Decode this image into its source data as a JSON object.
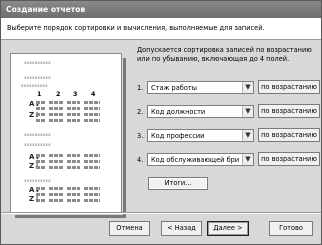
{
  "window": {
    "title": "Создание отчетов"
  },
  "header": {
    "instruction": "Выберите порядок сортировки и вычисления, выполняемые для записей."
  },
  "preview": {
    "placeholder": "xxxxxxxxxx",
    "column_numbers": [
      "1",
      "2",
      "3",
      "4"
    ]
  },
  "description": "Допускается сортировка записей по возрастанию или по убыванию, включающая до 4 полей.",
  "sort_fields": [
    {
      "number": "1.",
      "value": "Стаж работы",
      "order": "по возрастанию"
    },
    {
      "number": "2.",
      "value": "Код должности",
      "order": "по возрастанию"
    },
    {
      "number": "3.",
      "value": "Код профессии",
      "order": "по возрастанию"
    },
    {
      "number": "4.",
      "value": "Код обслуживающей бриг",
      "order": "по возрастанию"
    }
  ],
  "totals_label": "Итоги...",
  "buttons": {
    "cancel": "Отмена",
    "back": "< Назад",
    "next": "Далее >",
    "finish": "Готово"
  },
  "icons": {
    "combo_arrow": "chevron-down-icon"
  }
}
